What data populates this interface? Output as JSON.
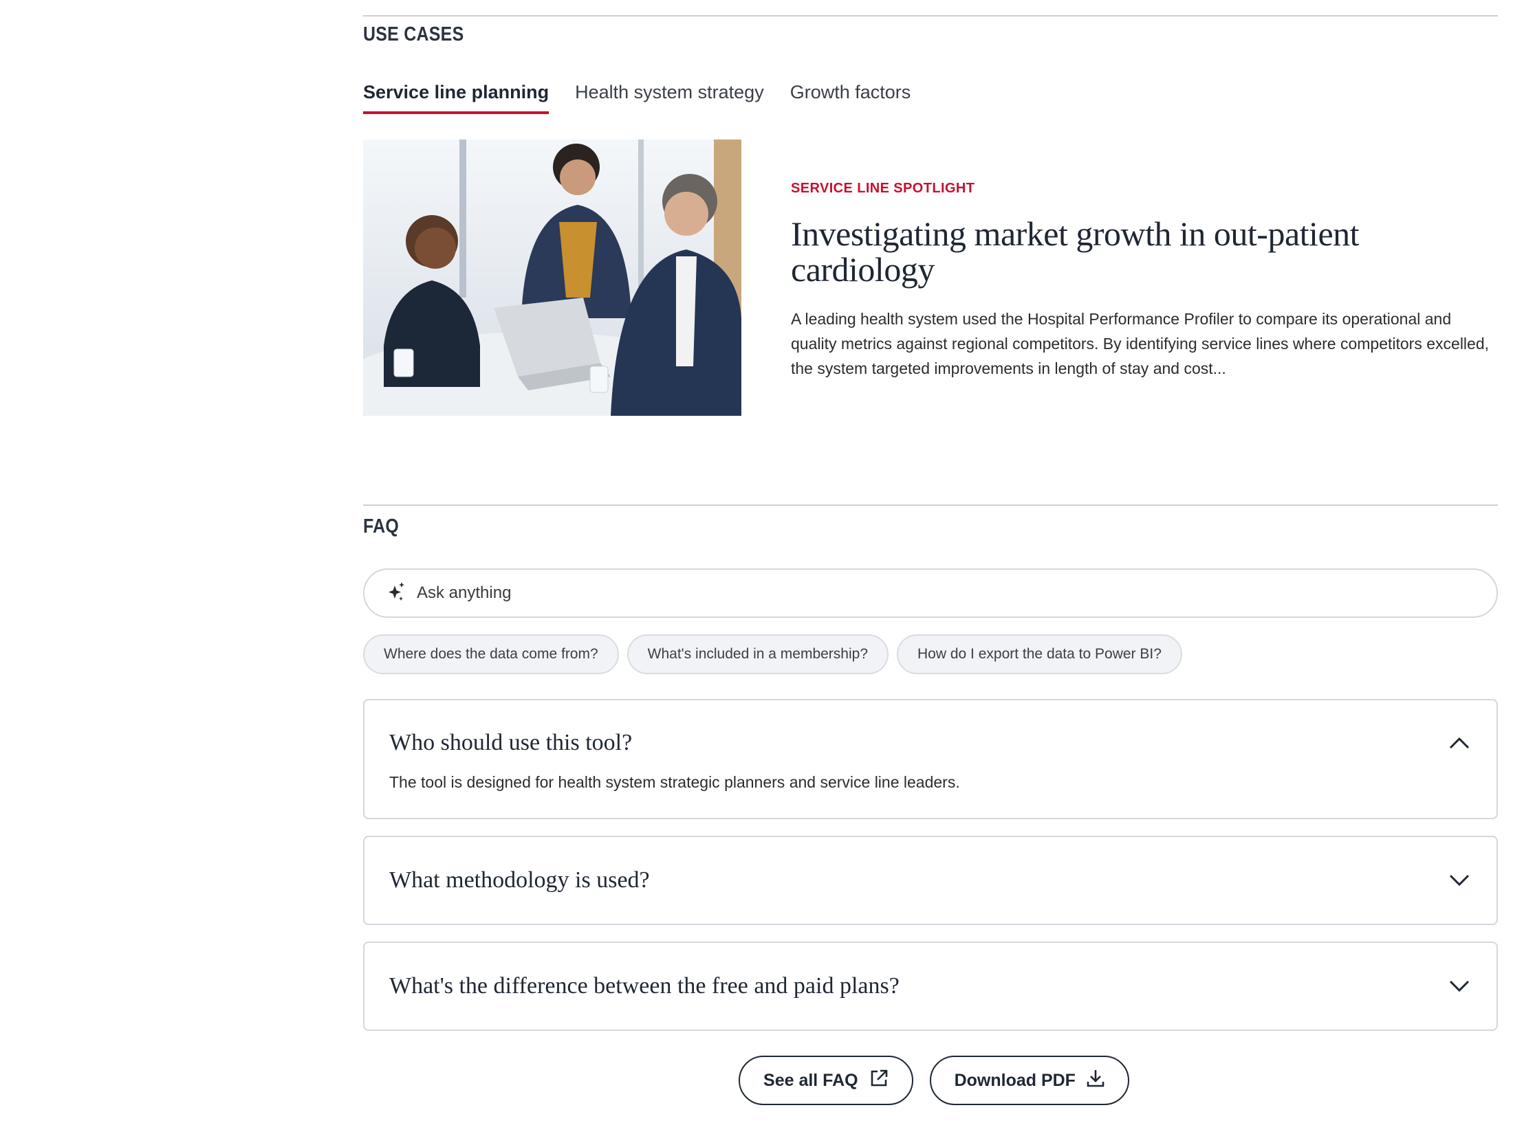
{
  "use_cases": {
    "title": "USE CASES",
    "tabs": [
      {
        "label": "Service line planning",
        "active": true
      },
      {
        "label": "Health system strategy",
        "active": false
      },
      {
        "label": "Growth factors",
        "active": false
      }
    ],
    "card": {
      "kicker": "SERVICE LINE SPOTLIGHT",
      "headline": "Investigating market growth in out-patient cardiology",
      "summary": "A leading health system used the Hospital Performance Profiler to compare its operational and quality metrics against regional competitors. By identifying service lines where competitors excelled, the system targeted improvements in length of stay and cost..."
    }
  },
  "faq": {
    "title": "FAQ",
    "ask_placeholder": "Ask anything",
    "suggestions": [
      "Where does the data come from?",
      "What's included in a membership?",
      "How do I export the data to Power BI?"
    ],
    "items": [
      {
        "question": "Who should use this tool?",
        "answer": "The tool is designed for health system strategic planners and service line leaders.",
        "open": true
      },
      {
        "question": "What methodology is used?",
        "open": false
      },
      {
        "question": "What's the difference between the free and paid plans?",
        "open": false
      }
    ],
    "actions": {
      "see_all": "See all FAQ",
      "download": "Download PDF"
    }
  },
  "colors": {
    "accent": "#c8102e",
    "text_dark": "#1f2733",
    "border": "#d4d7dc"
  }
}
